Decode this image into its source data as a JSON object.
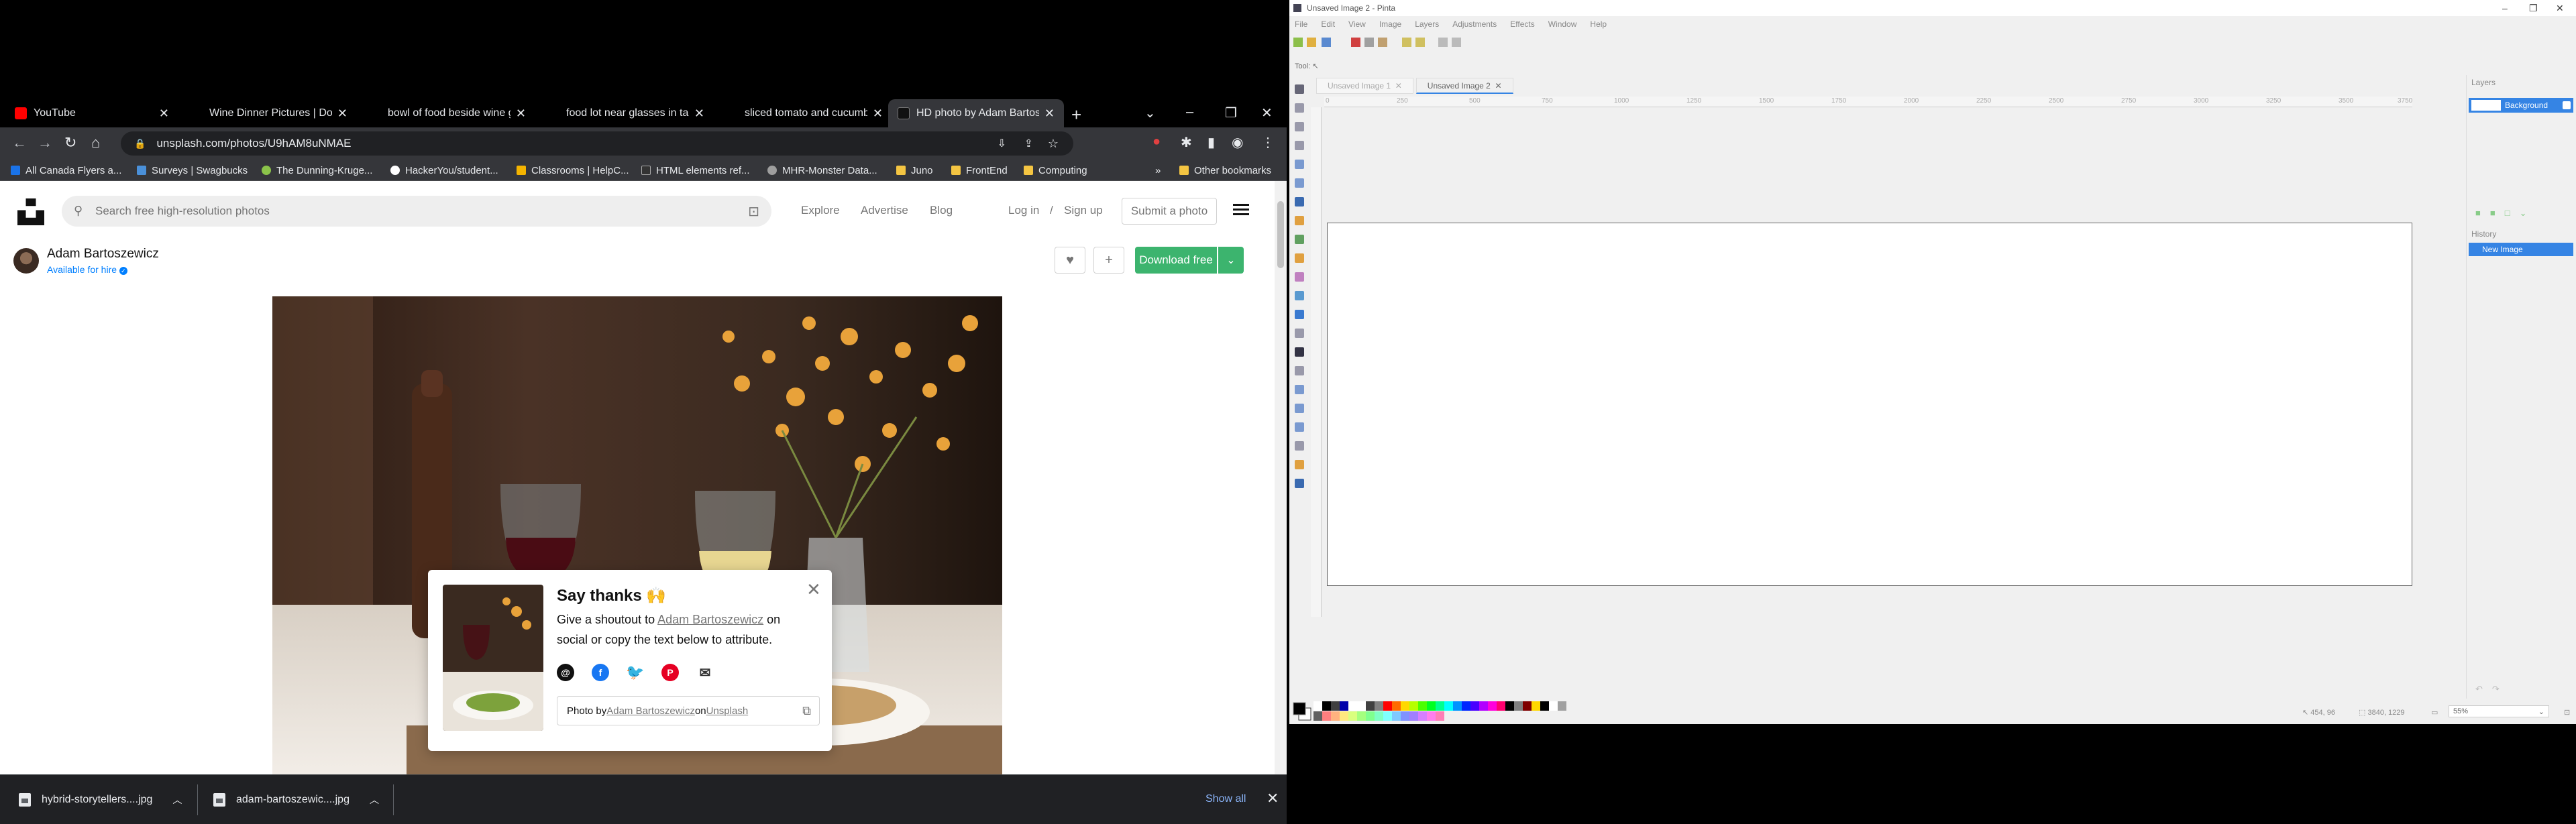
{
  "chrome": {
    "tabs": [
      {
        "title": "YouTube",
        "favicon_color": "#ff0000"
      },
      {
        "title": "Wine Dinner Pictures | Dow",
        "favicon_color": "#000000"
      },
      {
        "title": "bowl of food beside wine g",
        "favicon_color": "#000000"
      },
      {
        "title": "food lot near glasses in tab",
        "favicon_color": "#000000"
      },
      {
        "title": "sliced tomato and cucumbe",
        "favicon_color": "#000000"
      },
      {
        "title": "HD photo by Adam Bartosz",
        "favicon_color": "#111111",
        "active": true
      }
    ],
    "url": "unsplash.com/photos/U9hAM8uNMAE",
    "bookmarks": [
      {
        "label": "All Canada Flyers a...",
        "color": "#1a73e8"
      },
      {
        "label": "Surveys | Swagbucks",
        "color": "#4a90d9"
      },
      {
        "label": "The Dunning-Kruge...",
        "color": "#8bc34a"
      },
      {
        "label": "HackerYou/student...",
        "color": "#ffffff"
      },
      {
        "label": "Classrooms | HelpC...",
        "color": "#f4b400"
      },
      {
        "label": "HTML elements ref...",
        "color": "#333333"
      },
      {
        "label": "MHR-Monster Data...",
        "color": "#9e9e9e"
      },
      {
        "label": "Juno",
        "color": "#f4c542"
      },
      {
        "label": "FrontEnd",
        "color": "#f4c542"
      },
      {
        "label": "Computing",
        "color": "#f4c542"
      }
    ],
    "other_bookmarks": "Other bookmarks"
  },
  "unsplash": {
    "search_placeholder": "Search free high-resolution photos",
    "nav": [
      "Explore",
      "Advertise",
      "Blog"
    ],
    "login": "Log in",
    "slash": "/",
    "signup": "Sign up",
    "submit": "Submit a photo",
    "author": "Adam Bartoszewicz",
    "hire": "Available for hire",
    "download": "Download free",
    "accent": "#3cb46e"
  },
  "say_thanks": {
    "title": "Say thanks 🙌",
    "line1_pre": "Give a shoutout to ",
    "line1_name": "Adam Bartoszewicz",
    "line1_post": " on",
    "line2": "social or copy the text below to attribute.",
    "attr_pre": "Photo by ",
    "attr_name": "Adam Bartoszewicz",
    "attr_mid": " on ",
    "attr_site": "Unsplash"
  },
  "downloads": {
    "items": [
      "hybrid-storytellers....jpg",
      "adam-bartoszewic....jpg"
    ],
    "show_all": "Show all"
  },
  "pinta": {
    "title": "Unsaved Image 2 - Pinta",
    "menu": [
      "File",
      "Edit",
      "View",
      "Image",
      "Layers",
      "Adjustments",
      "Effects",
      "Window",
      "Help"
    ],
    "tool_label": "Tool:",
    "tabs": [
      "Unsaved Image 1",
      "Unsaved Image 2"
    ],
    "ruler": [
      "0",
      "250",
      "500",
      "750",
      "1000",
      "1250",
      "1500",
      "1750",
      "2000",
      "2250",
      "2500",
      "2750",
      "3000",
      "3250",
      "3500",
      "3750"
    ],
    "layers_title": "Layers",
    "layer_name": "Background",
    "history_title": "History",
    "history_item": "New Image",
    "cursor_pos": "454, 96",
    "selection_size": "3840, 1229",
    "zoom": "55%"
  }
}
